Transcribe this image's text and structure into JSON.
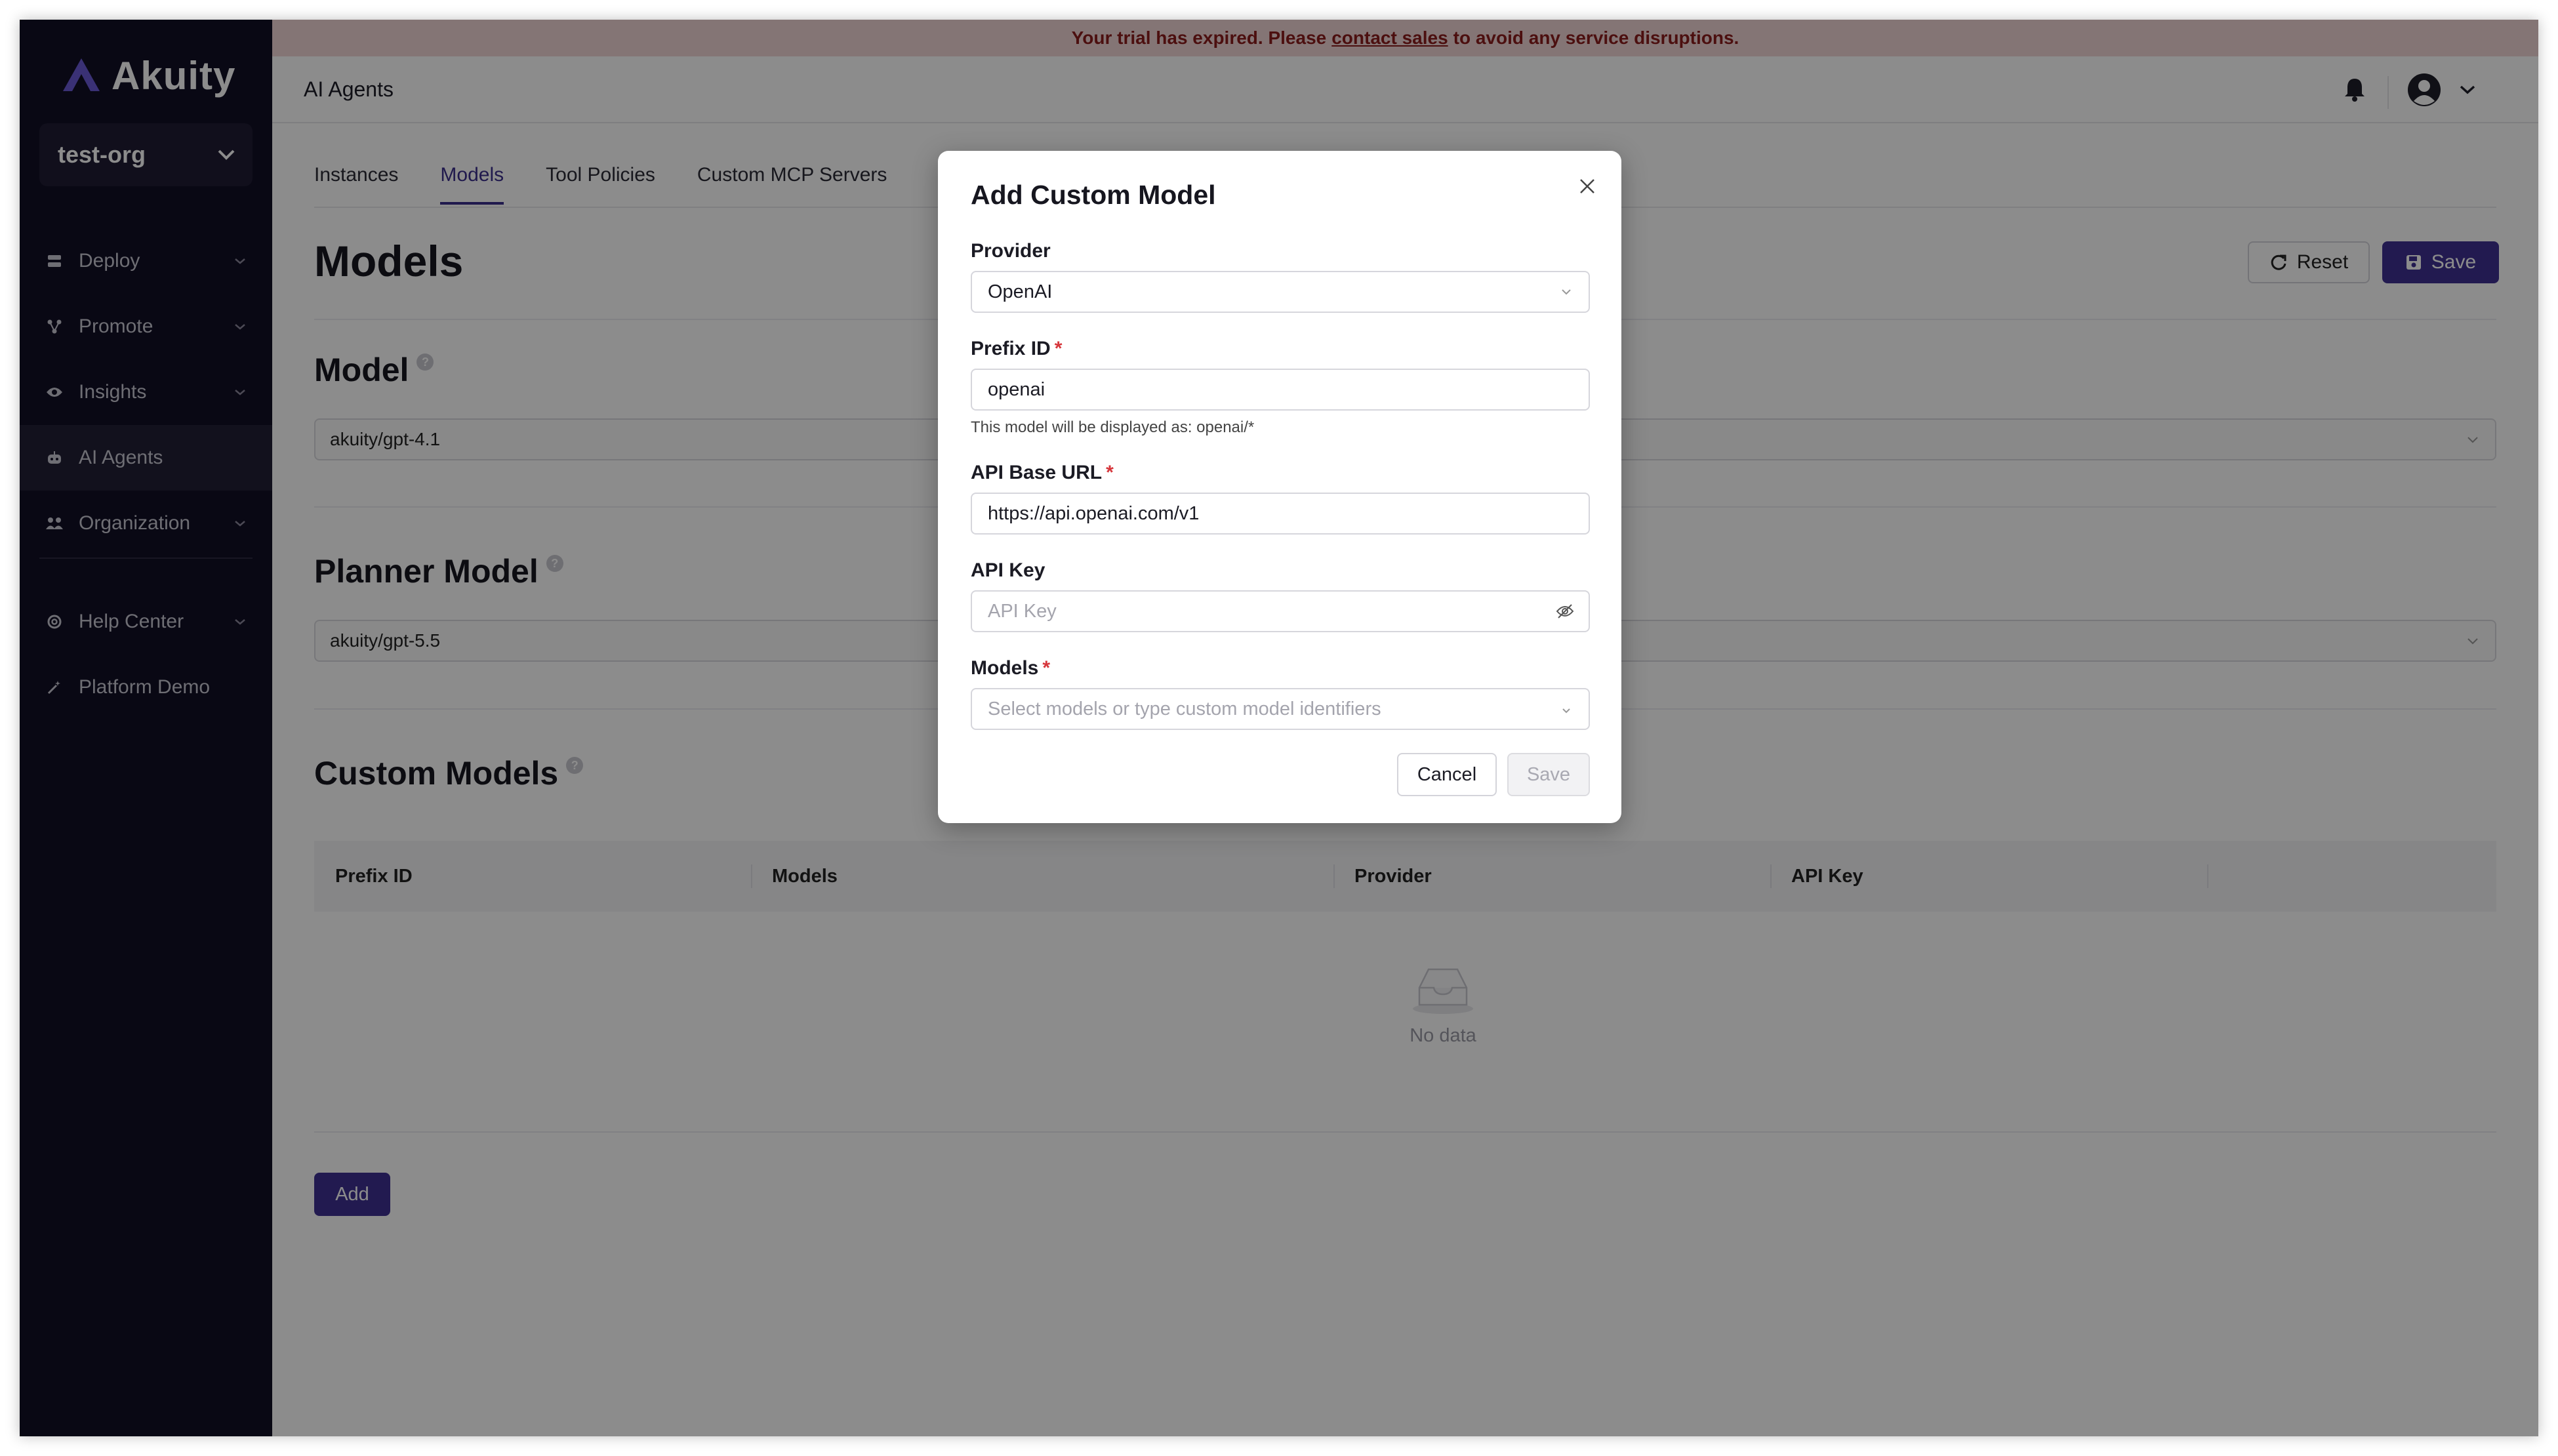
{
  "banner": {
    "prefix": "Your trial has expired. Please",
    "link": "contact sales",
    "suffix": "to avoid any service disruptions."
  },
  "sidebar": {
    "brand": "Akuity",
    "org": "test-org",
    "items": [
      {
        "label": "Deploy",
        "icon": "deploy-icon"
      },
      {
        "label": "Promote",
        "icon": "promote-icon"
      },
      {
        "label": "Insights",
        "icon": "eye-icon"
      },
      {
        "label": "AI Agents",
        "icon": "robot-icon"
      },
      {
        "label": "Organization",
        "icon": "people-icon"
      },
      {
        "label": "Help Center",
        "icon": "lifebuoy-icon"
      },
      {
        "label": "Platform Demo",
        "icon": "magic-wand-icon"
      }
    ]
  },
  "topbar": {
    "title": "AI Agents"
  },
  "tabs": [
    "Instances",
    "Models",
    "Tool Policies",
    "Custom MCP Servers"
  ],
  "page": {
    "title": "Models",
    "reset_label": "Reset",
    "save_label": "Save",
    "model_heading": "Model",
    "model_value": "akuity/gpt-4.1",
    "planner_heading": "Planner Model",
    "planner_value": "akuity/gpt-5.5",
    "custom_heading": "Custom Models",
    "table_headers": [
      "Prefix ID",
      "Models",
      "Provider",
      "API Key"
    ],
    "empty_text": "No data",
    "add_label": "Add"
  },
  "modal": {
    "title": "Add Custom Model",
    "provider_label": "Provider",
    "provider_value": "OpenAI",
    "prefix_label": "Prefix ID",
    "prefix_value": "openai",
    "prefix_hint": "This model will be displayed as: openai/*",
    "base_url_label": "API Base URL",
    "base_url_value": "https://api.openai.com/v1",
    "api_key_label": "API Key",
    "api_key_placeholder": "API Key",
    "models_label": "Models",
    "models_placeholder": "Select models or type custom model identifiers",
    "cancel_label": "Cancel",
    "save_label": "Save",
    "required_mark": "*"
  },
  "colors": {
    "sidebar_bg": "#120f26",
    "accent": "#3f3193",
    "banner_bg": "#f1d6d6",
    "banner_text": "#8b1d1d",
    "required": "#d6363b"
  }
}
